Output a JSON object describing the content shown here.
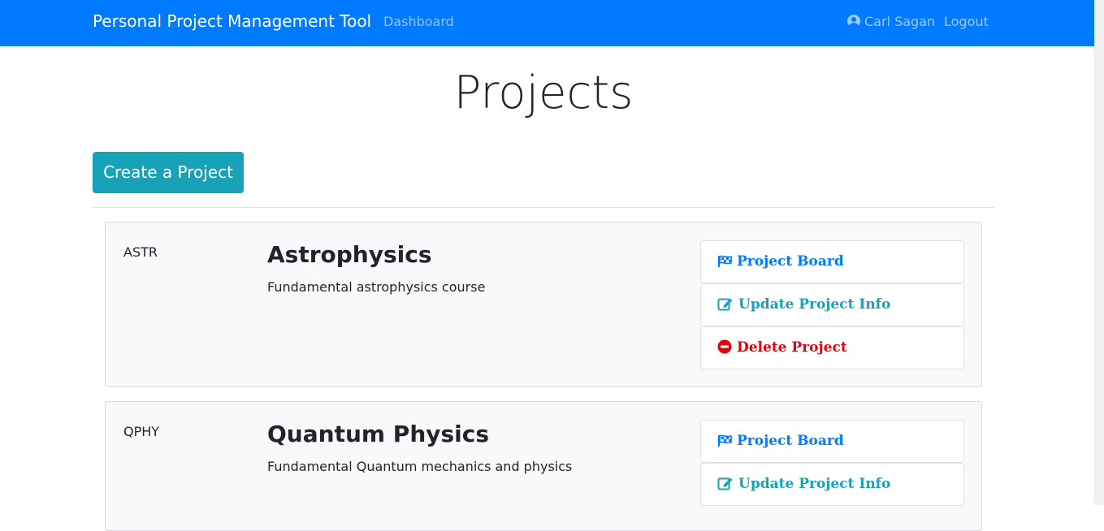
{
  "navbar": {
    "brand": "Personal Project Management Tool",
    "dashboard": "Dashboard",
    "user": "Carl Sagan",
    "logout": "Logout"
  },
  "page": {
    "title": "Projects",
    "create_button": "Create a Project"
  },
  "projects": [
    {
      "code": "ASTR",
      "name": "Astrophysics",
      "description": "Fundamental astrophysics course",
      "actions": {
        "board": "Project Board",
        "update": "Update Project Info",
        "delete": "Delete Project"
      }
    },
    {
      "code": "QPHY",
      "name": "Quantum Physics",
      "description": "Fundamental Quantum mechanics and physics",
      "actions": {
        "board": "Project Board",
        "update": "Update Project Info"
      }
    }
  ],
  "colors": {
    "navbar": "#007bff",
    "info": "#17a2b8",
    "danger": "#e3000b",
    "card_bg": "#f8f9fa"
  }
}
